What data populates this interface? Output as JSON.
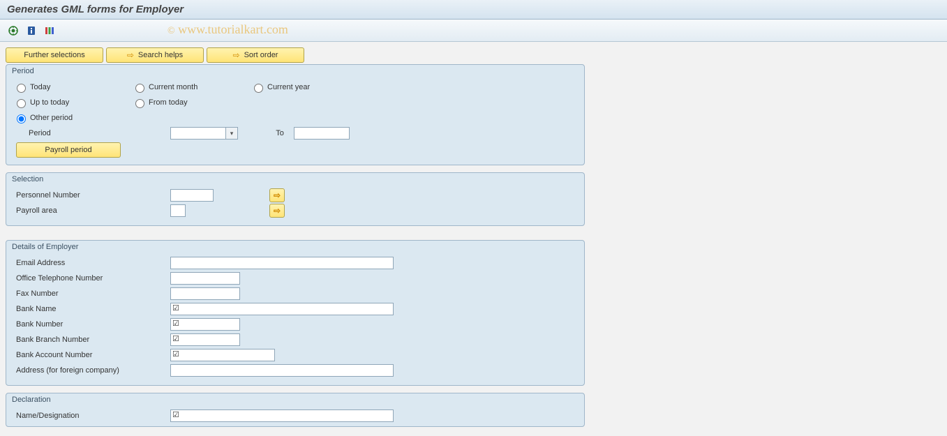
{
  "title": "Generates GML forms for Employer",
  "watermark": "© www.tutorialkart.com",
  "toolbar": {
    "execute_icon": "execute-icon",
    "info_icon": "info-icon",
    "variant_icon": "variant-icon"
  },
  "topButtons": {
    "further_selections": "Further selections",
    "search_helps": "Search helps",
    "sort_order": "Sort order"
  },
  "period": {
    "title": "Period",
    "today": "Today",
    "current_month": "Current month",
    "current_year": "Current year",
    "up_to_today": "Up to today",
    "from_today": "From today",
    "other_period": "Other period",
    "period_label": "Period",
    "period_value": "",
    "to_label": "To",
    "to_value": "",
    "payroll_period_btn": "Payroll period",
    "selected": "other_period"
  },
  "selection": {
    "title": "Selection",
    "personnel_number_label": "Personnel Number",
    "personnel_number_value": "",
    "payroll_area_label": "Payroll area",
    "payroll_area_value": ""
  },
  "details": {
    "title": "Details of Employer",
    "email_label": "Email Address",
    "email_value": "",
    "office_tel_label": "Office Telephone Number",
    "office_tel_value": "",
    "fax_label": "Fax Number",
    "fax_value": "",
    "bank_name_label": "Bank Name",
    "bank_name_value": "",
    "bank_name_chk": true,
    "bank_number_label": "Bank Number",
    "bank_number_value": "",
    "bank_number_chk": true,
    "bank_branch_label": "Bank Branch Number",
    "bank_branch_value": "",
    "bank_branch_chk": true,
    "bank_account_label": "Bank Account Number",
    "bank_account_value": "",
    "bank_account_chk": true,
    "address_label": "Address (for foreign company)",
    "address_value": ""
  },
  "declaration": {
    "title": "Declaration",
    "name_desig_label": "Name/Designation",
    "name_desig_value": "",
    "name_desig_chk": true
  }
}
